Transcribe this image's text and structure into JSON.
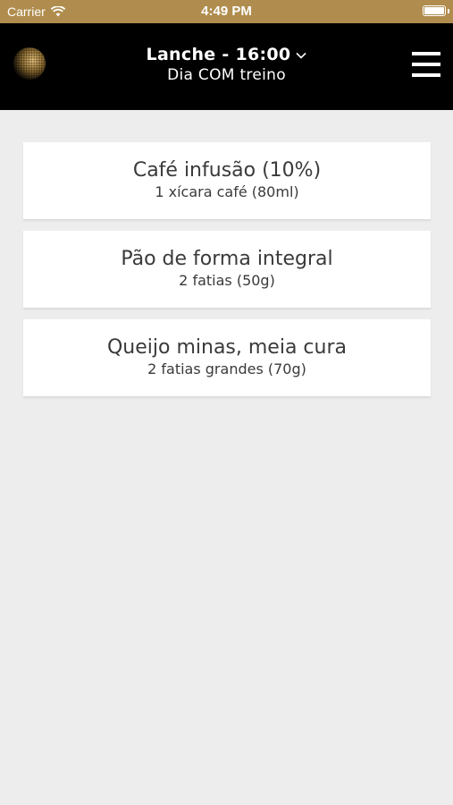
{
  "status_bar": {
    "carrier": "Carrier",
    "time": "4:49 PM",
    "battery_level": 1.0,
    "icons": [
      "wifi-icon",
      "battery-icon"
    ]
  },
  "header": {
    "title": "Lanche - 16:00",
    "subtitle": "Dia COM treino",
    "icons": [
      "logo-globe-icon",
      "chevron-down-icon",
      "hamburger-menu-icon"
    ]
  },
  "colors": {
    "status_bar_bg": "#b08d4e",
    "header_bg": "#000000",
    "page_bg": "#ededed",
    "card_bg": "#ffffff",
    "text": "#3a3a3a"
  },
  "foods": [
    {
      "name": "Café infusão (10%)",
      "portion": "1 xícara café (80ml)"
    },
    {
      "name": "Pão de forma integral",
      "portion": "2 fatias (50g)"
    },
    {
      "name": "Queijo minas, meia cura",
      "portion": "2 fatias grandes (70g)"
    }
  ]
}
